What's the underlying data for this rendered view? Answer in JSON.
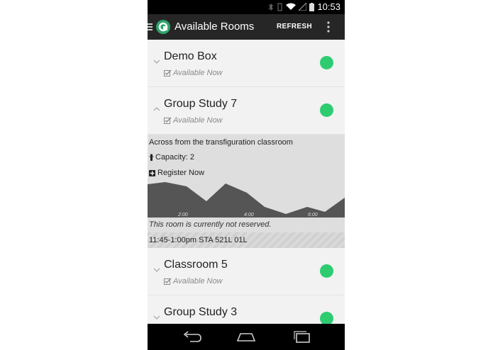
{
  "status": {
    "time": "10:53"
  },
  "header": {
    "title": "Available Rooms",
    "refresh_label": "REFRESH"
  },
  "rooms": [
    {
      "name": "Demo Box",
      "status": "Available Now",
      "expanded": false
    },
    {
      "name": "Group Study 7",
      "status": "Available Now",
      "expanded": true,
      "details": {
        "description": "Across from the transfiguration classroom",
        "capacity": "Capacity: 2",
        "register": "Register Now",
        "chart_ticks": [
          "2:00",
          "4:00",
          "6:00"
        ],
        "reservation_note": "This room is currently not reserved.",
        "booking": "11:45-1:00pm STA 521L 01L"
      }
    },
    {
      "name": "Classroom 5",
      "status": "Available Now",
      "expanded": false
    },
    {
      "name": "Group Study 3",
      "status": "",
      "expanded": false
    }
  ],
  "colors": {
    "available": "#2ecc71",
    "actionbar": "#262626",
    "logo": "#2ea46b"
  },
  "icons": {
    "nav": [
      "back-icon",
      "home-icon",
      "recent-apps-icon"
    ]
  }
}
